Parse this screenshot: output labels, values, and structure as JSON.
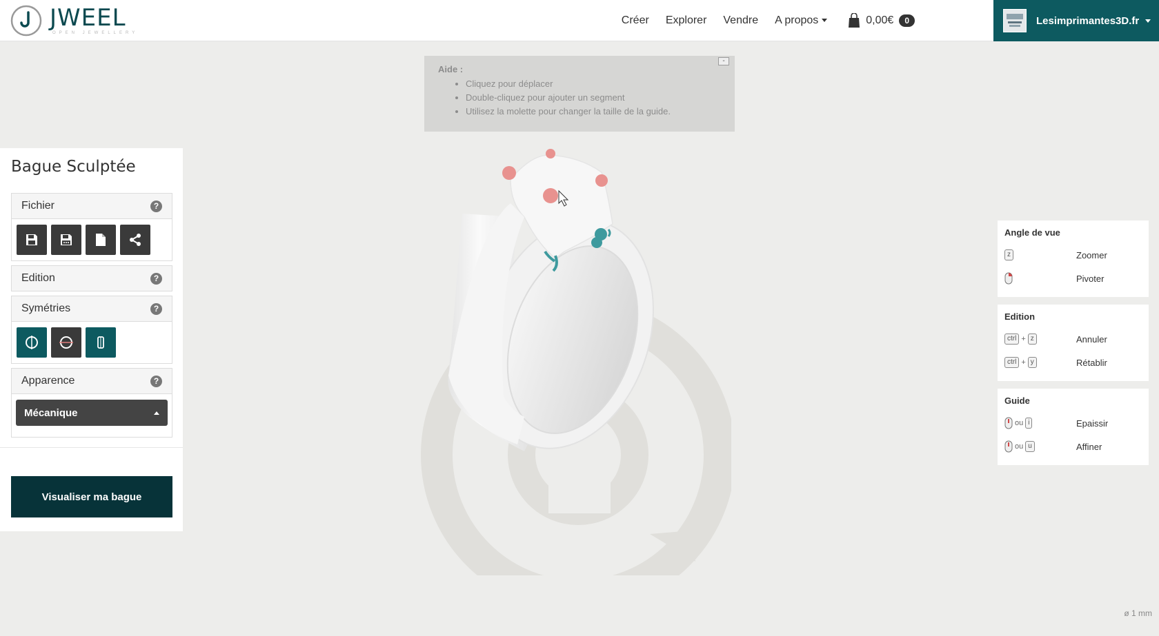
{
  "brand": {
    "name": "JWEEL",
    "tagline": "OPEN JEWELLERY",
    "color": "#0d5a60"
  },
  "nav": {
    "items": [
      "Créer",
      "Explorer",
      "Vendre",
      "A propos"
    ],
    "cart_total": "0,00€",
    "cart_count": "0",
    "user_name": "Lesimprimantes3D.fr"
  },
  "help": {
    "title": "Aide :",
    "collapse": "-",
    "items": [
      "Cliquez pour déplacer",
      "Double-cliquez pour ajouter un segment",
      "Utilisez la molette pour changer la taille de la guide."
    ]
  },
  "panel": {
    "title": "Bague Sculptée",
    "sections": {
      "fichier": "Fichier",
      "edition": "Edition",
      "symetries": "Symétries",
      "apparence": "Apparence"
    },
    "help_glyph": "?",
    "appearance_value": "Mécanique",
    "cta": "Visualiser ma bague"
  },
  "shortcuts": {
    "view": {
      "title": "Angle de vue",
      "zoom_key": "z",
      "zoom": "Zoomer",
      "rotate": "Pivoter"
    },
    "edition": {
      "title": "Edition",
      "ctrl": "ctrl",
      "plus": "+",
      "undo_key": "z",
      "undo": "Annuler",
      "redo_key": "y",
      "redo": "Rétablir"
    },
    "guide": {
      "title": "Guide",
      "ou": "ou",
      "thicken_key": "i",
      "thicken": "Epaissir",
      "thin_key": "u",
      "thin": "Affiner"
    }
  },
  "scale": "ø 1 mm"
}
